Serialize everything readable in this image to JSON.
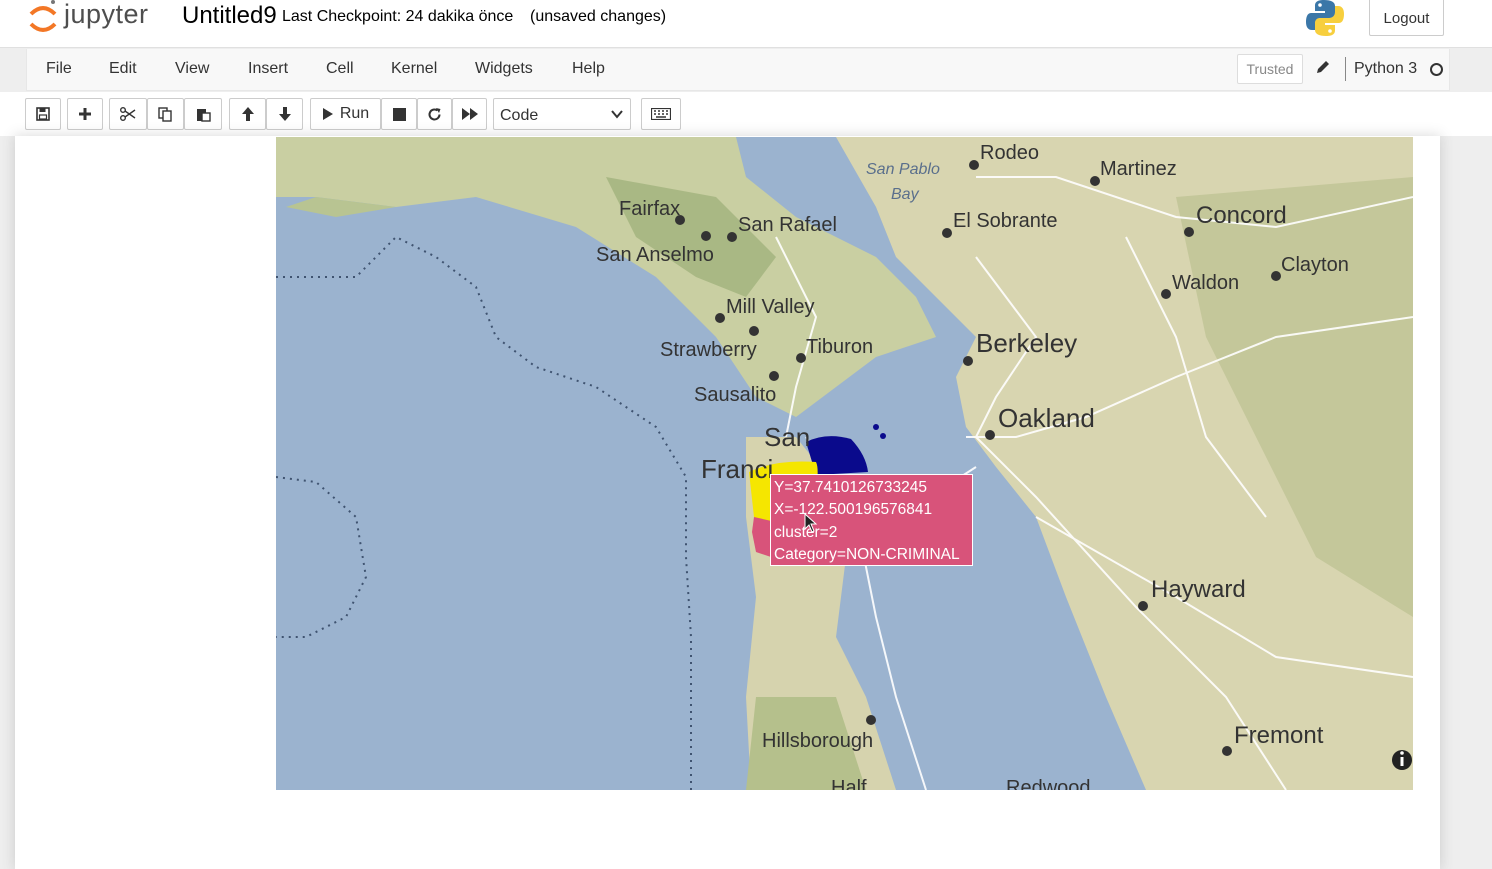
{
  "header": {
    "logo_text": "jupyter",
    "notebook_name": "Untitled9",
    "checkpoint": "Last Checkpoint: 24 dakika önce",
    "autosave_status": "(unsaved changes)",
    "logout_label": "Logout"
  },
  "menubar": {
    "items": [
      "File",
      "Edit",
      "View",
      "Insert",
      "Cell",
      "Kernel",
      "Widgets",
      "Help"
    ],
    "trusted_label": "Trusted",
    "kernel_name": "Python 3"
  },
  "toolbar": {
    "run_label": "Run",
    "cell_type": "Code",
    "icons": [
      "save-icon",
      "plus-icon",
      "scissors-icon",
      "copy-icon",
      "paste-icon",
      "arrow-up-icon",
      "arrow-down-icon",
      "play-icon",
      "stop-icon",
      "restart-icon",
      "fast-forward-icon",
      "keyboard-icon"
    ]
  },
  "map": {
    "place_labels": [
      "Rodeo",
      "Martinez",
      "San Pablo",
      "Bay",
      "Fairfax",
      "San Rafael",
      "El Sobrante",
      "Concord",
      "San Anselmo",
      "Clayton",
      "Waldon",
      "Mill Valley",
      "Berkeley",
      "Tiburon",
      "Strawberry",
      "Sausalito",
      "Oakland",
      "San",
      "Franci",
      "Hayward",
      "Hillsborough",
      "Fremont",
      "Half",
      "Redwood"
    ],
    "cluster_colors": {
      "cluster_yellow": "#f5e600",
      "cluster_navy": "#0a0a8c",
      "cluster_pink": "#d8537a"
    },
    "tooltip": {
      "y": "Y=37.7410126733245",
      "x": "X=-122.500196576841",
      "cluster": "cluster=2",
      "category": "Category=NON-CRIMINAL"
    }
  }
}
